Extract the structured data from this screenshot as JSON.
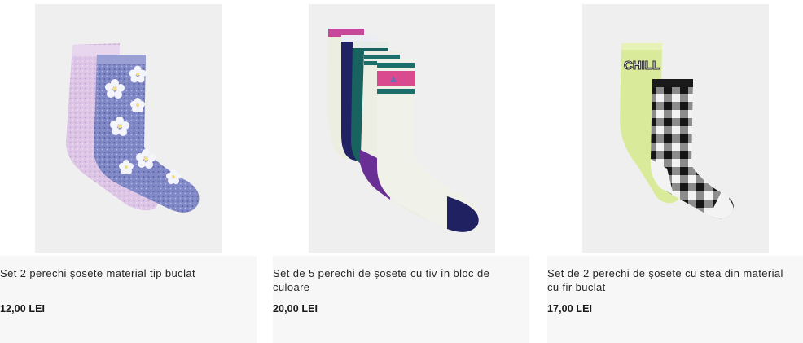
{
  "products": [
    {
      "title": "Set 2 perechi șosete material tip buclat",
      "price": "12,00 LEI",
      "image_icon": "socks-pastel-floral-image"
    },
    {
      "title": "Set de 5 perechi de șosete cu tiv în bloc de culoare",
      "price": "20,00 LEI",
      "image_icon": "socks-color-block-image"
    },
    {
      "title": "Set de 2 perechi de șosete cu stea din material cu fir buclat",
      "price": "17,00 LEI",
      "image_icon": "socks-chill-gingham-image",
      "sock_text": "CHILL"
    }
  ],
  "colors": {
    "image_bg": "#f0efef",
    "info_bg": "#f7f7f7",
    "text": "#262626",
    "lilac": "#d9c3e3",
    "periwinkle": "#7c85c4",
    "navy": "#1f2160",
    "teal": "#17615f",
    "magenta": "#d9458a",
    "cream": "#eef0e6",
    "lime": "#d8ea97",
    "black": "#151515"
  }
}
